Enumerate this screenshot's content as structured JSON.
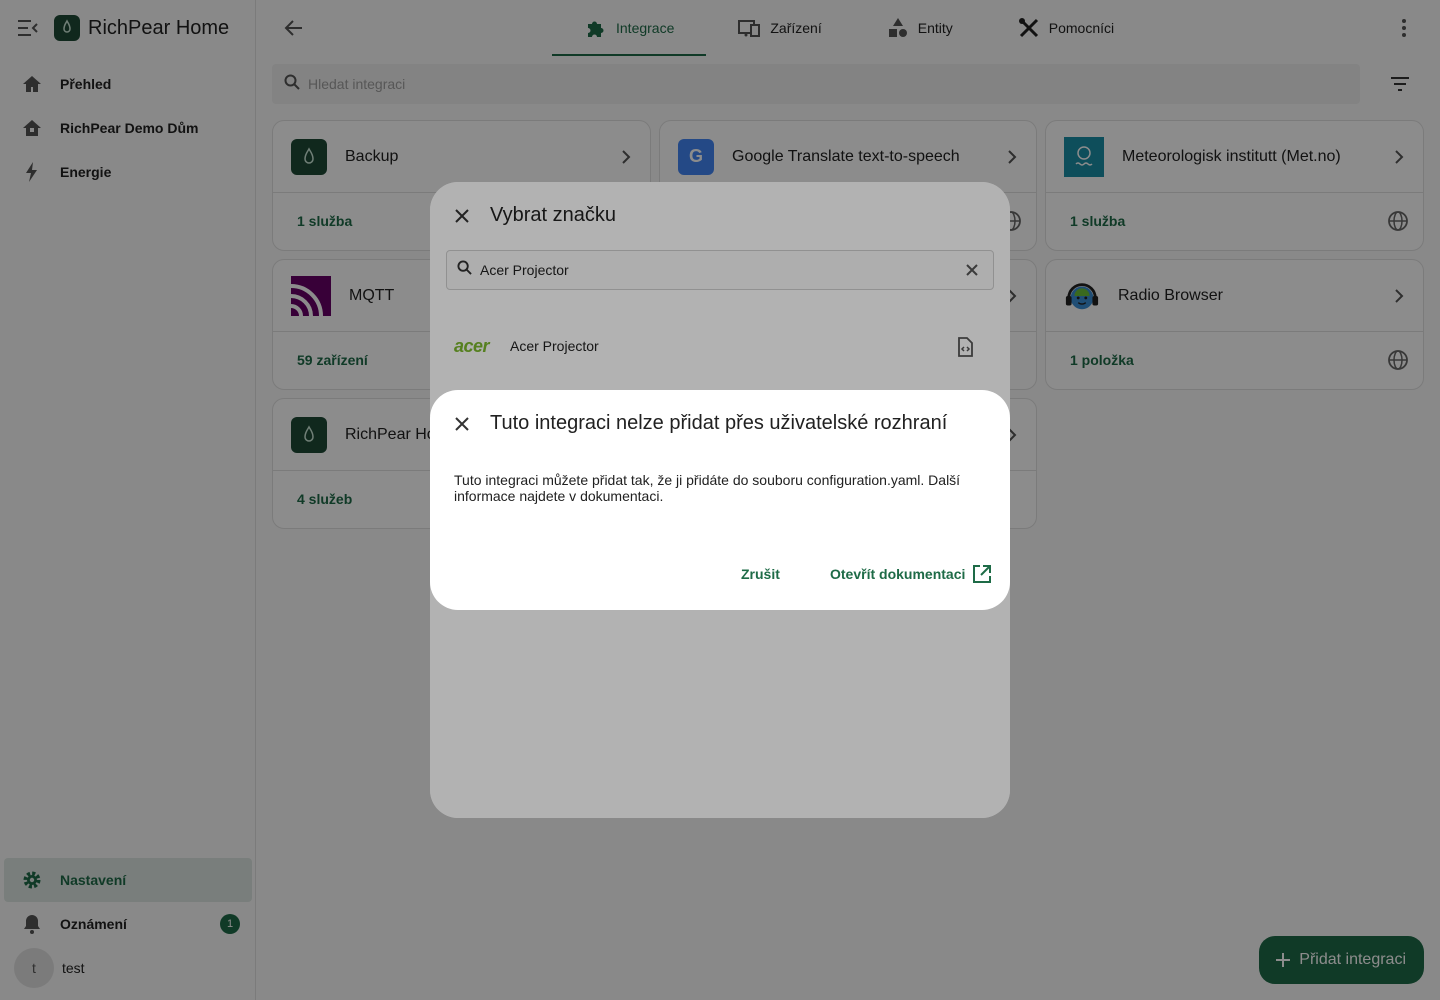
{
  "sidebar": {
    "app_title": "RichPear Home",
    "items": [
      {
        "label": "Přehled"
      },
      {
        "label": "RichPear Demo Dům"
      },
      {
        "label": "Energie"
      }
    ],
    "bottom": {
      "settings": "Nastavení",
      "notifications": "Oznámení",
      "notifications_count": "1",
      "user_initial": "t",
      "user_name": "test"
    }
  },
  "tabs": [
    {
      "label": "Integrace",
      "icon": "puzzle-icon",
      "active": true
    },
    {
      "label": "Zařízení",
      "icon": "devices-icon"
    },
    {
      "label": "Entity",
      "icon": "shapes-icon"
    },
    {
      "label": "Pomocníci",
      "icon": "tools-icon"
    }
  ],
  "search": {
    "placeholder": "Hledat integraci"
  },
  "cards": [
    {
      "title": "Backup",
      "footer": "1 služba"
    },
    {
      "title": "Google Translate text-to-speech",
      "footer": ""
    },
    {
      "title": "Meteorologisk institutt (Met.no)",
      "footer": "1 služba"
    },
    {
      "title": "MQTT",
      "footer": "59 zařízení"
    },
    {
      "title": "",
      "footer": ""
    },
    {
      "title": "Radio Browser",
      "footer": "1 položka"
    },
    {
      "title": "RichPear Ho",
      "footer": "4 služeb"
    },
    {
      "title": "",
      "footer": ""
    }
  ],
  "fab": {
    "label": "Přidat integraci"
  },
  "brand_dialog": {
    "title": "Vybrat značku",
    "search_value": "Acer Projector",
    "result_logo_text": "acer",
    "result_name": "Acer Projector"
  },
  "alert_dialog": {
    "title": "Tuto integraci nelze přidat přes uživatelské rozhraní",
    "body": "Tuto integraci můžete přidat tak, že ji přidáte do souboru configuration.yaml. Další informace najdete v dokumentaci.",
    "cancel": "Zrušit",
    "open_docs": "Otevřít dokumentaci"
  },
  "colors": {
    "accent": "#1e6b47",
    "mqtt": "#660066",
    "metno": "#1b8fa6",
    "acer": "#7cb82f"
  }
}
